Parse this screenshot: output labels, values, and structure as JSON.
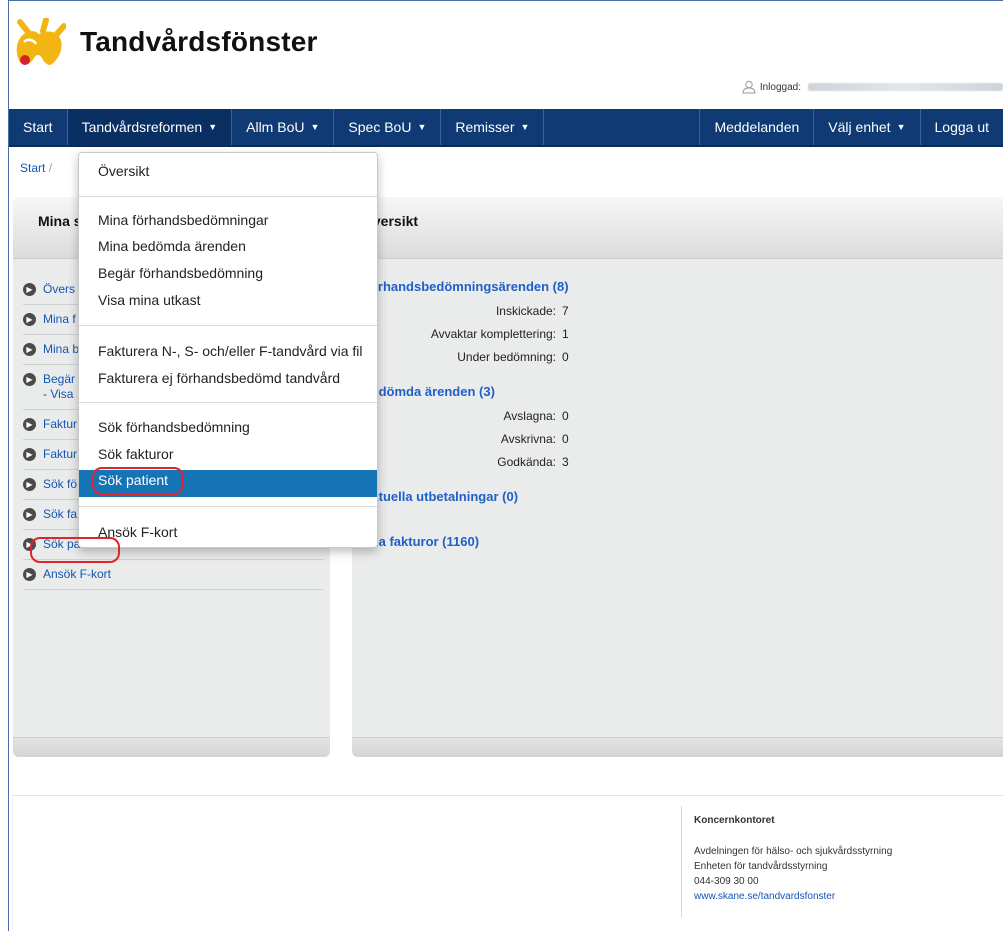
{
  "app": {
    "title": "Tandvårdsfönster"
  },
  "user": {
    "label": "Inloggad:"
  },
  "nav": {
    "items": [
      {
        "label": "Start"
      },
      {
        "label": "Tandvårdsreformen"
      },
      {
        "label": "Allm BoU"
      },
      {
        "label": "Spec BoU"
      },
      {
        "label": "Remisser"
      }
    ],
    "right": [
      {
        "label": "Meddelanden"
      },
      {
        "label": "Välj enhet"
      },
      {
        "label": "Logga ut"
      }
    ]
  },
  "breadcrumb": {
    "home": "Start",
    "sep": "/"
  },
  "sidebar": {
    "title": "Mina s",
    "items": [
      {
        "label": "Övers"
      },
      {
        "label": "Mina f"
      },
      {
        "label": "Mina b"
      },
      {
        "label": "Begär",
        "label2": "- Visa"
      },
      {
        "label": "Faktur"
      },
      {
        "label": "Faktur"
      },
      {
        "label": "Sök fö"
      },
      {
        "label": "Sök fa"
      },
      {
        "label": "Sök patient"
      },
      {
        "label": "Ansök F-kort"
      }
    ]
  },
  "main": {
    "title": "Översikt",
    "sections": [
      {
        "title": "Förhandsbedömningsärenden (8)",
        "rows": [
          {
            "label": "Inskickade:",
            "value": "7"
          },
          {
            "label": "Avvaktar komplettering:",
            "value": "1"
          },
          {
            "label": "Under bedömning:",
            "value": "0"
          }
        ]
      },
      {
        "title": "Bedömda ärenden (3)",
        "rows": [
          {
            "label": "Avslagna:",
            "value": "0"
          },
          {
            "label": "Avskrivna:",
            "value": "0"
          },
          {
            "label": "Godkända:",
            "value": "3"
          }
        ]
      },
      {
        "title": "Aktuella utbetalningar (0)",
        "rows": []
      },
      {
        "title": "Alla fakturor (1160)",
        "rows": []
      }
    ]
  },
  "dropdown": {
    "items": [
      "Översikt",
      "Mina förhandsbedömningar",
      "Mina bedömda ärenden",
      "Begär förhandsbedömning",
      "Visa mina utkast",
      "Fakturera N-, S- och/eller F-tandvård via fil",
      "Fakturera ej förhandsbedömd tandvård",
      "Sök förhandsbedömning",
      "Sök fakturor",
      "Sök patient",
      "Ansök F-kort"
    ],
    "selected": "Sök patient"
  },
  "footer": {
    "org": "Koncernkontoret",
    "line1": "Avdelningen för hälso- och sjukvårdsstyrning",
    "line2": "Enheten för tandvårdsstyrning",
    "phone": "044-309 30 00",
    "link": "www.skane.se/tandvardsfonster"
  },
  "colors": {
    "nav": "#0f3a74",
    "link": "#1456b5",
    "selected": "#1574b5",
    "highlight": "#e0242c"
  }
}
